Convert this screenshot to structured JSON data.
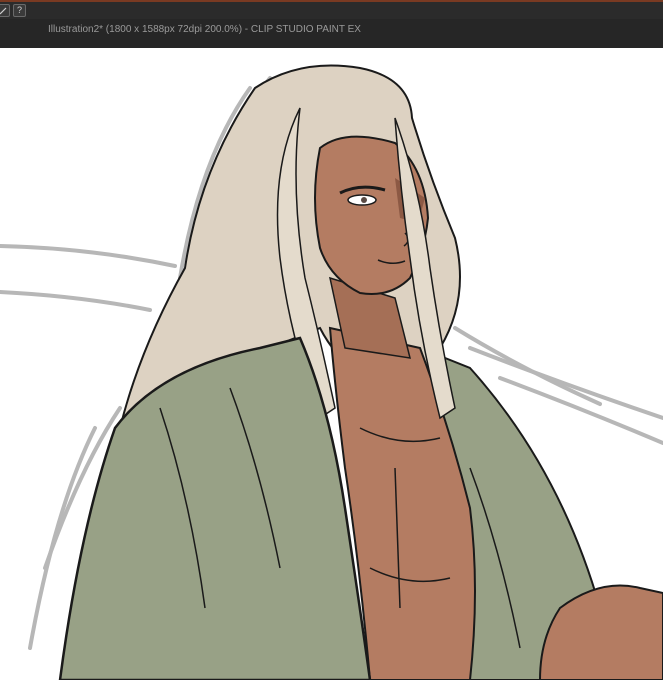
{
  "window": {
    "title": "Illustration2* (1800 x 1588px 72dpi 200.0%)  - CLIP STUDIO PAINT EX"
  },
  "toolbar": {
    "icons": [
      "brush-tool-icon",
      "help-icon"
    ],
    "help_glyph": "?"
  },
  "colors": {
    "topbar": "#2b2b2b",
    "titlebar": "#262626",
    "canvas": "#ffffff",
    "hair": "#ddd2c2",
    "skin": "#b47c62",
    "robe": "#98a186",
    "sketch_lines": "#b5b5b5",
    "ink": "#1a1a1a"
  }
}
